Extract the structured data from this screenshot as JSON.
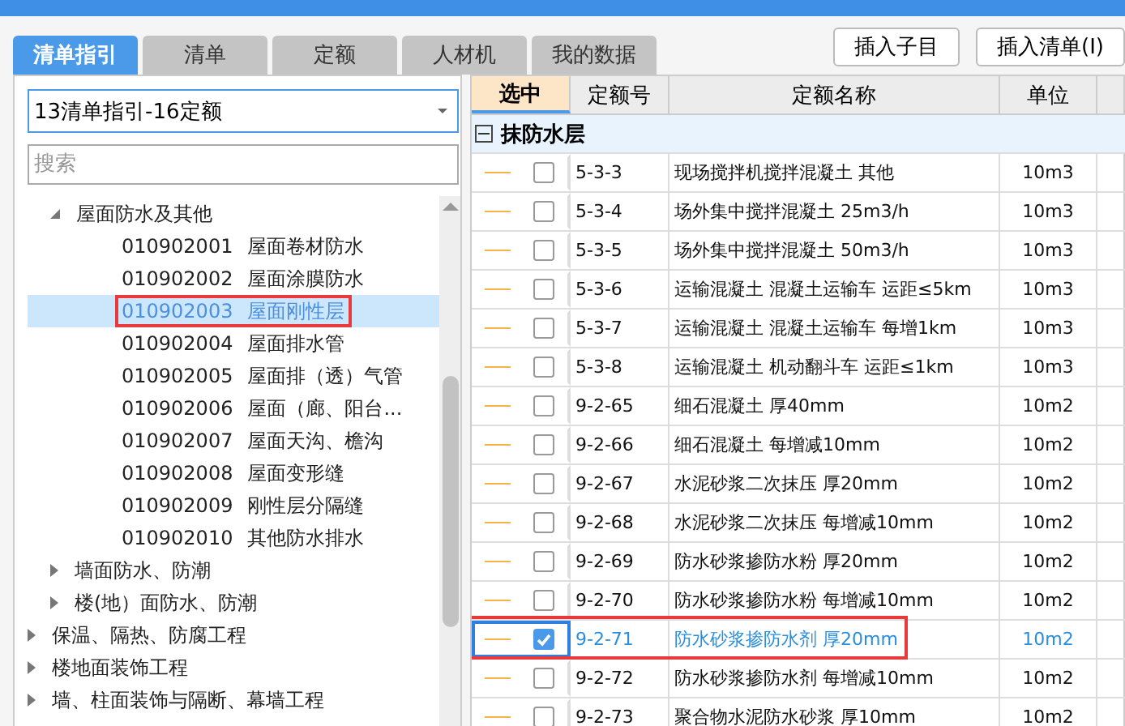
{
  "tabs": [
    {
      "label": "清单指引",
      "selected": true
    },
    {
      "label": "清单",
      "selected": false
    },
    {
      "label": "定额",
      "selected": false
    },
    {
      "label": "人材机",
      "selected": false
    },
    {
      "label": "我的数据",
      "selected": false
    }
  ],
  "buttons": [
    "插入子目",
    "插入清单(I)"
  ],
  "library_select": {
    "value": "13清单指引-16定额"
  },
  "search": {
    "placeholder": "搜索"
  },
  "tree": [
    {
      "children": [
        {
          "label": "屋面防水及其他",
          "expanded": true,
          "children": [
            {
              "code": "010902001",
              "label": "屋面卷材防水",
              "selected": false,
              "highlighted": false
            },
            {
              "code": "010902002",
              "label": "屋面涂膜防水",
              "selected": false,
              "highlighted": false
            },
            {
              "code": "010902003",
              "label": "屋面刚性层",
              "selected": true,
              "highlighted": true
            },
            {
              "code": "010902004",
              "label": "屋面排水管",
              "selected": false,
              "highlighted": false
            },
            {
              "code": "010902005",
              "label": "屋面排（透）气管",
              "selected": false,
              "highlighted": false
            },
            {
              "code": "010902006",
              "label": "屋面（廊、阳台...",
              "selected": false,
              "highlighted": false
            },
            {
              "code": "010902007",
              "label": "屋面天沟、檐沟",
              "selected": false,
              "highlighted": false
            },
            {
              "code": "010902008",
              "label": "屋面变形缝",
              "selected": false,
              "highlighted": false
            },
            {
              "code": "010902009",
              "label": "刚性层分隔缝",
              "selected": false,
              "highlighted": false
            },
            {
              "code": "010902010",
              "label": "其他防水排水",
              "selected": false,
              "highlighted": false
            }
          ]
        },
        {
          "label": "墙面防水、防潮",
          "expanded": false
        },
        {
          "label": "楼(地）面防水、防潮",
          "expanded": false
        }
      ]
    },
    {
      "label": "保温、隔热、防腐工程",
      "expanded": false
    },
    {
      "label": "楼地面装饰工程",
      "expanded": false
    },
    {
      "label": "墙、柱面装饰与隔断、幕墙工程",
      "expanded": false
    }
  ],
  "table": {
    "columns": [
      "选中",
      "定额号",
      "定额名称",
      "单位"
    ],
    "group": {
      "label": "抹防水层",
      "expanded": true
    },
    "rows": [
      {
        "code": "5-3-3",
        "name": "现场搅拌机搅拌混凝土 其他",
        "unit": "10m3",
        "checked": false,
        "highlighted": false
      },
      {
        "code": "5-3-4",
        "name": "场外集中搅拌混凝土 25m3/h",
        "unit": "10m3",
        "checked": false,
        "highlighted": false
      },
      {
        "code": "5-3-5",
        "name": "场外集中搅拌混凝土 50m3/h",
        "unit": "10m3",
        "checked": false,
        "highlighted": false
      },
      {
        "code": "5-3-6",
        "name": "运输混凝土 混凝土运输车 运距≤5km",
        "unit": "10m3",
        "checked": false,
        "highlighted": false
      },
      {
        "code": "5-3-7",
        "name": "运输混凝土 混凝土运输车 每增1km",
        "unit": "10m3",
        "checked": false,
        "highlighted": false
      },
      {
        "code": "5-3-8",
        "name": "运输混凝土 机动翻斗车 运距≤1km",
        "unit": "10m3",
        "checked": false,
        "highlighted": false
      },
      {
        "code": "9-2-65",
        "name": "细石混凝土 厚40mm",
        "unit": "10m2",
        "checked": false,
        "highlighted": false
      },
      {
        "code": "9-2-66",
        "name": "细石混凝土 每增减10mm",
        "unit": "10m2",
        "checked": false,
        "highlighted": false
      },
      {
        "code": "9-2-67",
        "name": "水泥砂浆二次抹压 厚20mm",
        "unit": "10m2",
        "checked": false,
        "highlighted": false
      },
      {
        "code": "9-2-68",
        "name": "水泥砂浆二次抹压 每增减10mm",
        "unit": "10m2",
        "checked": false,
        "highlighted": false
      },
      {
        "code": "9-2-69",
        "name": "防水砂浆掺防水粉 厚20mm",
        "unit": "10m2",
        "checked": false,
        "highlighted": false
      },
      {
        "code": "9-2-70",
        "name": "防水砂浆掺防水粉 每增减10mm",
        "unit": "10m2",
        "checked": false,
        "highlighted": false
      },
      {
        "code": "9-2-71",
        "name": "防水砂浆掺防水剂 厚20mm",
        "unit": "10m2",
        "checked": true,
        "highlighted": true
      },
      {
        "code": "9-2-72",
        "name": "防水砂浆掺防水剂 每增减10mm",
        "unit": "10m2",
        "checked": false,
        "highlighted": false
      },
      {
        "code": "9-2-73",
        "name": "聚合物水泥防水砂浆 厚10mm",
        "unit": "10m2",
        "checked": false,
        "highlighted": false
      }
    ]
  }
}
